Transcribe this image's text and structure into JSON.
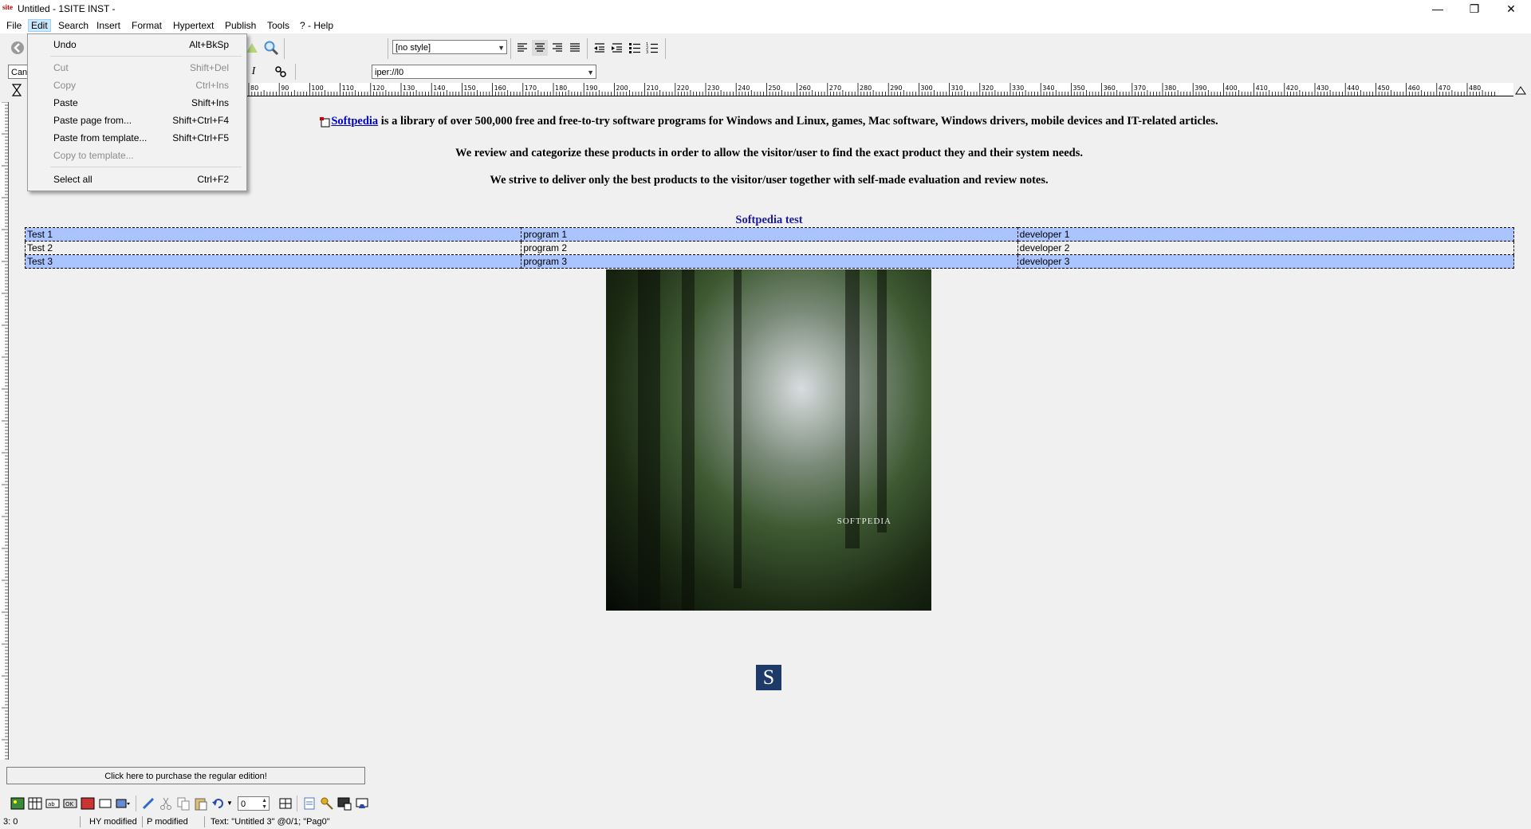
{
  "window": {
    "title": "Untitled - 1SITE INST -",
    "icon_text": "site",
    "controls": {
      "minimize": "—",
      "maximize": "❐",
      "close": "✕"
    }
  },
  "menubar": [
    "File",
    "Edit",
    "Search",
    "Insert",
    "Format",
    "Hypertext",
    "Publish",
    "Tools",
    "? - Help"
  ],
  "toolbar": {
    "style_combo": "[no style]",
    "font_combo": "Can",
    "url_combo": "iper://l0"
  },
  "ruler": {
    "labels": [
      "80",
      "90",
      "100",
      "110",
      "120",
      "130",
      "140",
      "150",
      "160",
      "170",
      "180",
      "190",
      "200",
      "210",
      "220",
      "230",
      "240",
      "250",
      "260",
      "270",
      "280",
      "290",
      "300",
      "310",
      "320",
      "330",
      "340",
      "350",
      "360",
      "370",
      "380",
      "390",
      "400",
      "410",
      "420",
      "430",
      "440",
      "450",
      "460",
      "470",
      "480"
    ]
  },
  "edit_menu": {
    "items": [
      {
        "label": "Undo",
        "shortcut": "Alt+BkSp",
        "enabled": true
      },
      {
        "label": "Cut",
        "shortcut": "Shift+Del",
        "enabled": false
      },
      {
        "label": "Copy",
        "shortcut": "Ctrl+Ins",
        "enabled": false
      },
      {
        "label": "Paste",
        "shortcut": "Shift+Ins",
        "enabled": true
      },
      {
        "label": "Paste page from...",
        "shortcut": "Shift+Ctrl+F4",
        "enabled": true
      },
      {
        "label": "Paste from template...",
        "shortcut": "Shift+Ctrl+F5",
        "enabled": true
      },
      {
        "label": "Copy to template...",
        "shortcut": "",
        "enabled": false
      },
      {
        "label": "Select all",
        "shortcut": "Ctrl+F2",
        "enabled": true
      }
    ]
  },
  "content": {
    "para1_link": "Softpedia",
    "para1_rest": " is a library of over 500,000 free and free-to-try software programs for Windows and Linux, games, Mac software, Windows drivers, mobile devices and IT-related articles.",
    "para2": "We review and categorize these products in order to allow the visitor/user to find the exact product they and their system needs.",
    "para3": "We strive to deliver only the best products to the visitor/user together with self-made evaluation and review notes.",
    "table_caption": "Softpedia test",
    "table_rows": [
      [
        "Test 1",
        "program 1",
        "developer 1"
      ],
      [
        "Test 2",
        "program 2",
        "developer 2"
      ],
      [
        "Test 3",
        "program 3",
        "developer 3"
      ]
    ],
    "image_logo": "SOFTPEDIA",
    "s_logo": "S"
  },
  "purchase_button": "Click here to purchase the regular edition!",
  "bottom_toolbar": {
    "spinner_value": "0"
  },
  "statusbar": {
    "position": "3: 0",
    "hy": "HY modified",
    "p": "P modified",
    "text": "Text: \"Untitled 3\" @0/1; \"Pag0\""
  },
  "colors": {
    "selection_row": "#a9c4ff",
    "menu_highlight": "#cce8ff",
    "link": "#0000cc"
  }
}
